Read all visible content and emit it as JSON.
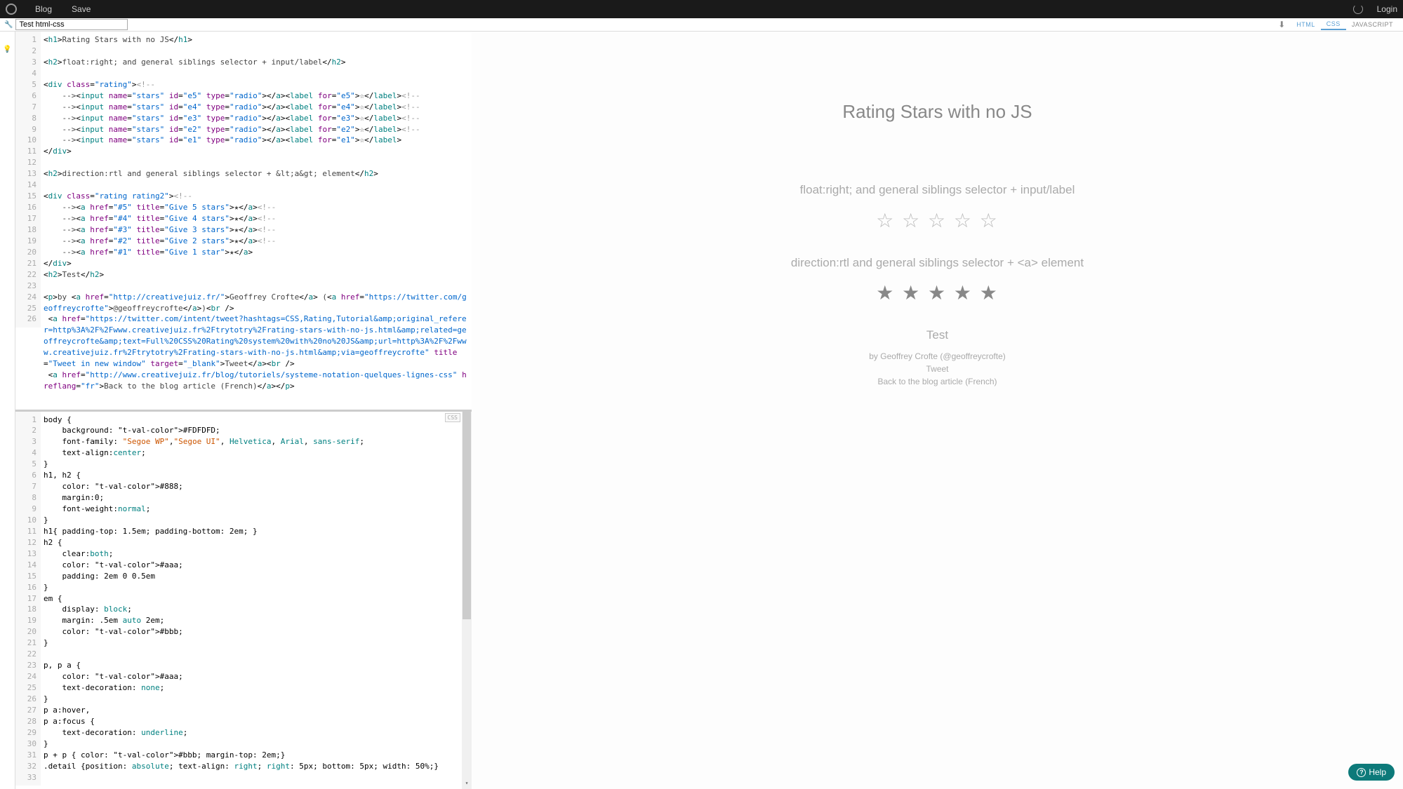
{
  "topbar": {
    "blog": "Blog",
    "save": "Save",
    "login": "Login"
  },
  "subbar": {
    "title_input_value": "Test html-css",
    "tab_html": "HTML",
    "tab_css": "CSS",
    "tab_js": "JAVASCRIPT"
  },
  "html_editor": {
    "line_numbers": [
      "1",
      "2",
      "3",
      "4",
      "5",
      "6",
      "7",
      "8",
      "9",
      "10",
      "11",
      "12",
      "13",
      "14",
      "15",
      "16",
      "17",
      "18",
      "19",
      "20",
      "21",
      "22",
      "23",
      "24",
      "25",
      "",
      "26"
    ],
    "lines": [
      {
        "raw": "<h1>Rating Stars with no JS</h1>"
      },
      {
        "raw": ""
      },
      {
        "raw": "<h2>float:right; and general siblings selector + input/label</h2>"
      },
      {
        "raw": ""
      },
      {
        "raw": "<div class=\"rating\"><!--"
      },
      {
        "raw": "    --><input name=\"stars\" id=\"e5\" type=\"radio\"></a><label for=\"e5\">☆</label><!--"
      },
      {
        "raw": "    --><input name=\"stars\" id=\"e4\" type=\"radio\"></a><label for=\"e4\">☆</label><!--"
      },
      {
        "raw": "    --><input name=\"stars\" id=\"e3\" type=\"radio\"></a><label for=\"e3\">☆</label><!--"
      },
      {
        "raw": "    --><input name=\"stars\" id=\"e2\" type=\"radio\"></a><label for=\"e2\">☆</label><!--"
      },
      {
        "raw": "    --><input name=\"stars\" id=\"e1\" type=\"radio\"></a><label for=\"e1\">☆</label>"
      },
      {
        "raw": "</div>"
      },
      {
        "raw": ""
      },
      {
        "raw": "<h2>direction:rtl and general siblings selector + &lt;a&gt; element</h2>"
      },
      {
        "raw": ""
      },
      {
        "raw": "<div class=\"rating rating2\"><!--"
      },
      {
        "raw": "    --><a href=\"#5\" title=\"Give 5 stars\">★</a><!--"
      },
      {
        "raw": "    --><a href=\"#4\" title=\"Give 4 stars\">★</a><!--"
      },
      {
        "raw": "    --><a href=\"#3\" title=\"Give 3 stars\">★</a><!--"
      },
      {
        "raw": "    --><a href=\"#2\" title=\"Give 2 stars\">★</a><!--"
      },
      {
        "raw": "    --><a href=\"#1\" title=\"Give 1 star\">★</a>"
      },
      {
        "raw": "</div>"
      },
      {
        "raw": "<h2>Test</h2>"
      },
      {
        "raw": ""
      },
      {
        "raw": "<p>by <a href=\"http://creativejuiz.fr/\">Geoffrey Crofte</a> (<a href=\"https://twitter.com/geoffreycrofte\">@geoffreycrofte</a>)<br />"
      },
      {
        "raw": " <a href=\"https://twitter.com/intent/tweet?hashtags=CSS,Rating,Tutorial&amp;original_referer=http%3A%2F%2Fwww.creativejuiz.fr%2Ftrytotry%2Frating-stars-with-no-js.html&amp;related=geoffreycrofte&amp;text=Full%20CSS%20Rating%20system%20with%20no%20JS&amp;url=http%3A%2F%2Fwww.creativejuiz.fr%2Ftrytotry%2Frating-stars-with-no-js.html&amp;via=geoffreycrofte\" title=\"Tweet in new window\" target=\"_blank\">Tweet</a><br />"
      },
      {
        "raw": " <a href=\"http://www.creativejuiz.fr/blog/tutoriels/systeme-notation-quelques-lignes-css\" hreflang=\"fr\">Back to the blog article (French)</a></p>"
      }
    ]
  },
  "css_editor": {
    "badge": "CSS",
    "line_numbers": [
      "1",
      "2",
      "3",
      "4",
      "5",
      "6",
      "7",
      "8",
      "9",
      "10",
      "11",
      "12",
      "13",
      "14",
      "15",
      "16",
      "17",
      "18",
      "19",
      "20",
      "21",
      "22",
      "23",
      "24",
      "25",
      "26",
      "27",
      "28",
      "29",
      "30",
      "31",
      "32",
      "33"
    ],
    "lines": [
      "body {",
      "    background: #FDFDFD;",
      "    font-family: \"Segoe WP\",\"Segoe UI\", Helvetica, Arial, sans-serif;",
      "    text-align:center;",
      "}",
      "h1, h2 {",
      "    color: #888;",
      "    margin:0;",
      "    font-weight:normal;",
      "}",
      "h1{ padding-top: 1.5em; padding-bottom: 2em; }",
      "h2 {",
      "    clear:both;",
      "    color: #aaa;",
      "    padding: 2em 0 0.5em",
      "}",
      "em {",
      "    display: block;",
      "    margin: .5em auto 2em;",
      "    color: #bbb;",
      "}",
      "",
      "p, p a {",
      "    color: #aaa;",
      "    text-decoration: none;",
      "}",
      "p a:hover,",
      "p a:focus {",
      "    text-decoration: underline;",
      "}",
      "p + p { color: #bbb; margin-top: 2em;}",
      ".detail {position: absolute; text-align: right; right: 5px; bottom: 5px; width: 50%;}",
      ""
    ]
  },
  "preview": {
    "h1": "Rating Stars with no JS",
    "h2_1": "float:right; and general siblings selector + input/label",
    "stars_empty": "☆ ☆ ☆ ☆ ☆",
    "h2_2": "direction:rtl and general siblings selector + <a> element",
    "stars_filled": "★ ★ ★ ★ ★",
    "h2_3": "Test",
    "p_by": "by ",
    "p_author": "Geoffrey Crofte",
    "p_handle_open": " (",
    "p_handle": "@geoffreycrofte",
    "p_handle_close": ")",
    "p_tweet": "Tweet",
    "p_back": "Back to the blog article (French)"
  },
  "help": {
    "label": "Help"
  }
}
